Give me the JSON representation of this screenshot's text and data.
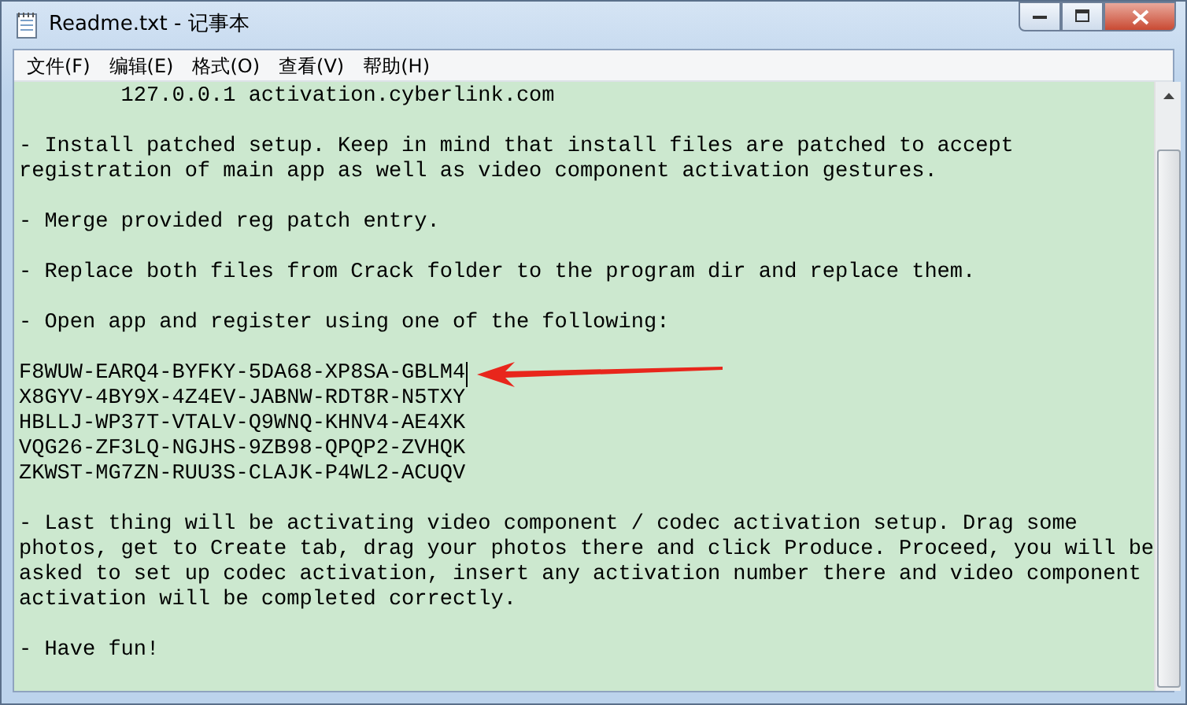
{
  "window": {
    "title": "Readme.txt - 记事本"
  },
  "menu": [
    {
      "label": "文件(F)"
    },
    {
      "label": "编辑(E)"
    },
    {
      "label": "格式(O)"
    },
    {
      "label": "查看(V)"
    },
    {
      "label": "帮助(H)"
    }
  ],
  "paragraphs": [
    {
      "lines": [
        {
          "text": "        127.0.0.1 activation.cyberlink.com",
          "cursor": false
        }
      ]
    },
    {
      "lines": [
        {
          "text": "- Install patched setup. Keep in mind that install files are patched to accept",
          "cursor": false
        },
        {
          "text": "registration of main app as well as video component activation gestures.",
          "cursor": false
        }
      ]
    },
    {
      "lines": [
        {
          "text": "- Merge provided reg patch entry.",
          "cursor": false
        }
      ]
    },
    {
      "lines": [
        {
          "text": "- Replace both files from Crack folder to the program dir and replace them.",
          "cursor": false
        }
      ]
    },
    {
      "lines": [
        {
          "text": "- Open app and register using one of the following:",
          "cursor": false
        }
      ]
    },
    {
      "lines": [
        {
          "text": "F8WUW-EARQ4-BYFKY-5DA68-XP8SA-GBLM4",
          "cursor": true
        },
        {
          "text": "X8GYV-4BY9X-4Z4EV-JABNW-RDT8R-N5TXY",
          "cursor": false
        },
        {
          "text": "HBLLJ-WP37T-VTALV-Q9WNQ-KHNV4-AE4XK",
          "cursor": false
        },
        {
          "text": "VQG26-ZF3LQ-NGJHS-9ZB98-QPQP2-ZVHQK",
          "cursor": false
        },
        {
          "text": "ZKWST-MG7ZN-RUU3S-CLAJK-P4WL2-ACUQV",
          "cursor": false
        }
      ]
    },
    {
      "lines": [
        {
          "text": "- Last thing will be activating video component / codec activation setup. Drag some",
          "cursor": false
        },
        {
          "text": "photos, get to Create tab, drag your photos there and click Produce. Proceed, you will be",
          "cursor": false
        },
        {
          "text": "asked to set up codec activation, insert any activation number there and video component",
          "cursor": false
        },
        {
          "text": "activation will be completed correctly.",
          "cursor": false
        }
      ]
    },
    {
      "lines": [
        {
          "text": "- Have fun!",
          "cursor": false
        }
      ]
    }
  ]
}
